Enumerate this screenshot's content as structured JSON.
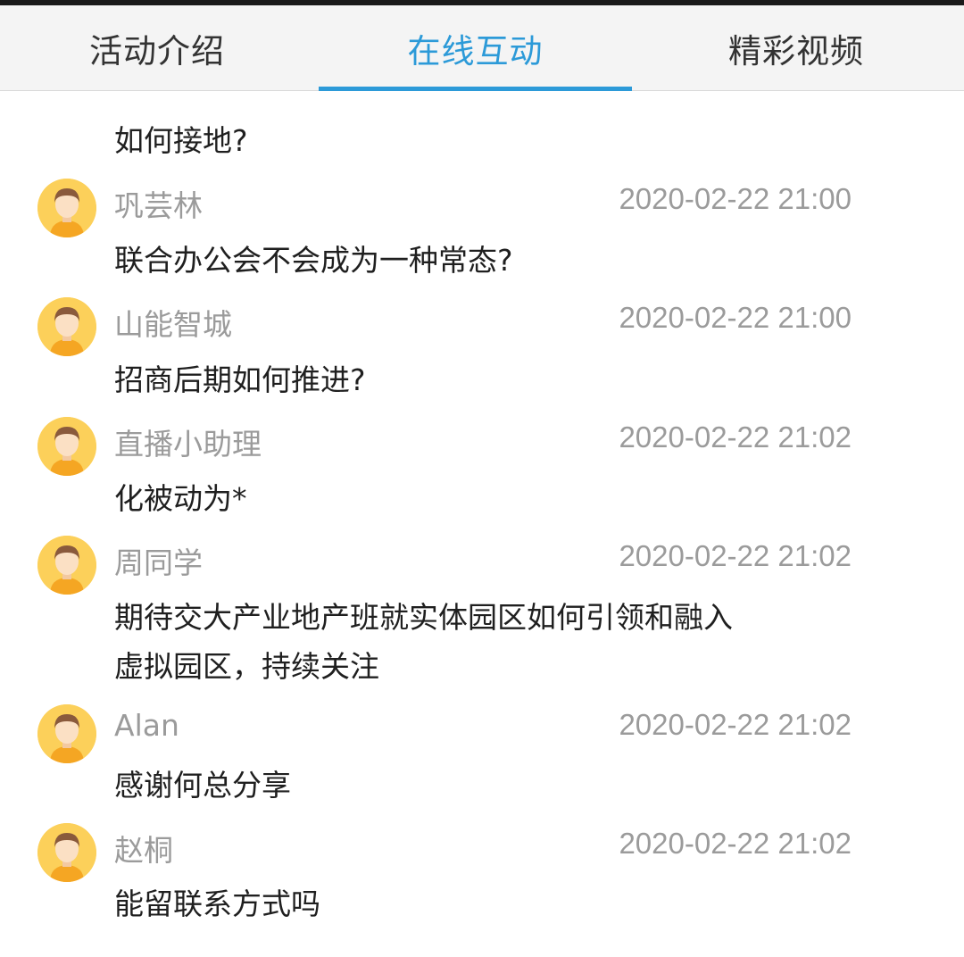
{
  "tabs": [
    {
      "label": "活动介绍",
      "active": false
    },
    {
      "label": "在线互动",
      "active": true
    },
    {
      "label": "精彩视频",
      "active": false
    }
  ],
  "colors": {
    "accent": "#2c9ad8",
    "avatar_bg": "#fcd05a",
    "meta_text": "#9b9b9b"
  },
  "chat": {
    "first_message": "如何接地?",
    "messages": [
      {
        "user": "巩芸林",
        "time": "2020-02-22 21:00",
        "lines": [
          "联合办公会不会成为一种常态?"
        ],
        "avatar_icon": "user-avatar-icon"
      },
      {
        "user": "山能智城",
        "time": "2020-02-22 21:00",
        "lines": [
          "招商后期如何推进?"
        ],
        "avatar_icon": "user-avatar-icon"
      },
      {
        "user": "直播小助理",
        "time": "2020-02-22 21:02",
        "lines": [
          "化被动为*"
        ],
        "avatar_icon": "user-avatar-icon"
      },
      {
        "user": "周同学",
        "time": "2020-02-22 21:02",
        "lines": [
          "期待交大产业地产班就实体园区如何引领和融入",
          "虚拟园区，持续关注"
        ],
        "avatar_icon": "user-avatar-icon"
      },
      {
        "user": "Alan",
        "time": "2020-02-22 21:02",
        "lines": [
          "感谢何总分享"
        ],
        "avatar_icon": "user-avatar-icon"
      },
      {
        "user": "赵桐",
        "time": "2020-02-22 21:02",
        "lines": [
          "能留联系方式吗"
        ],
        "avatar_icon": "user-avatar-icon"
      }
    ]
  }
}
